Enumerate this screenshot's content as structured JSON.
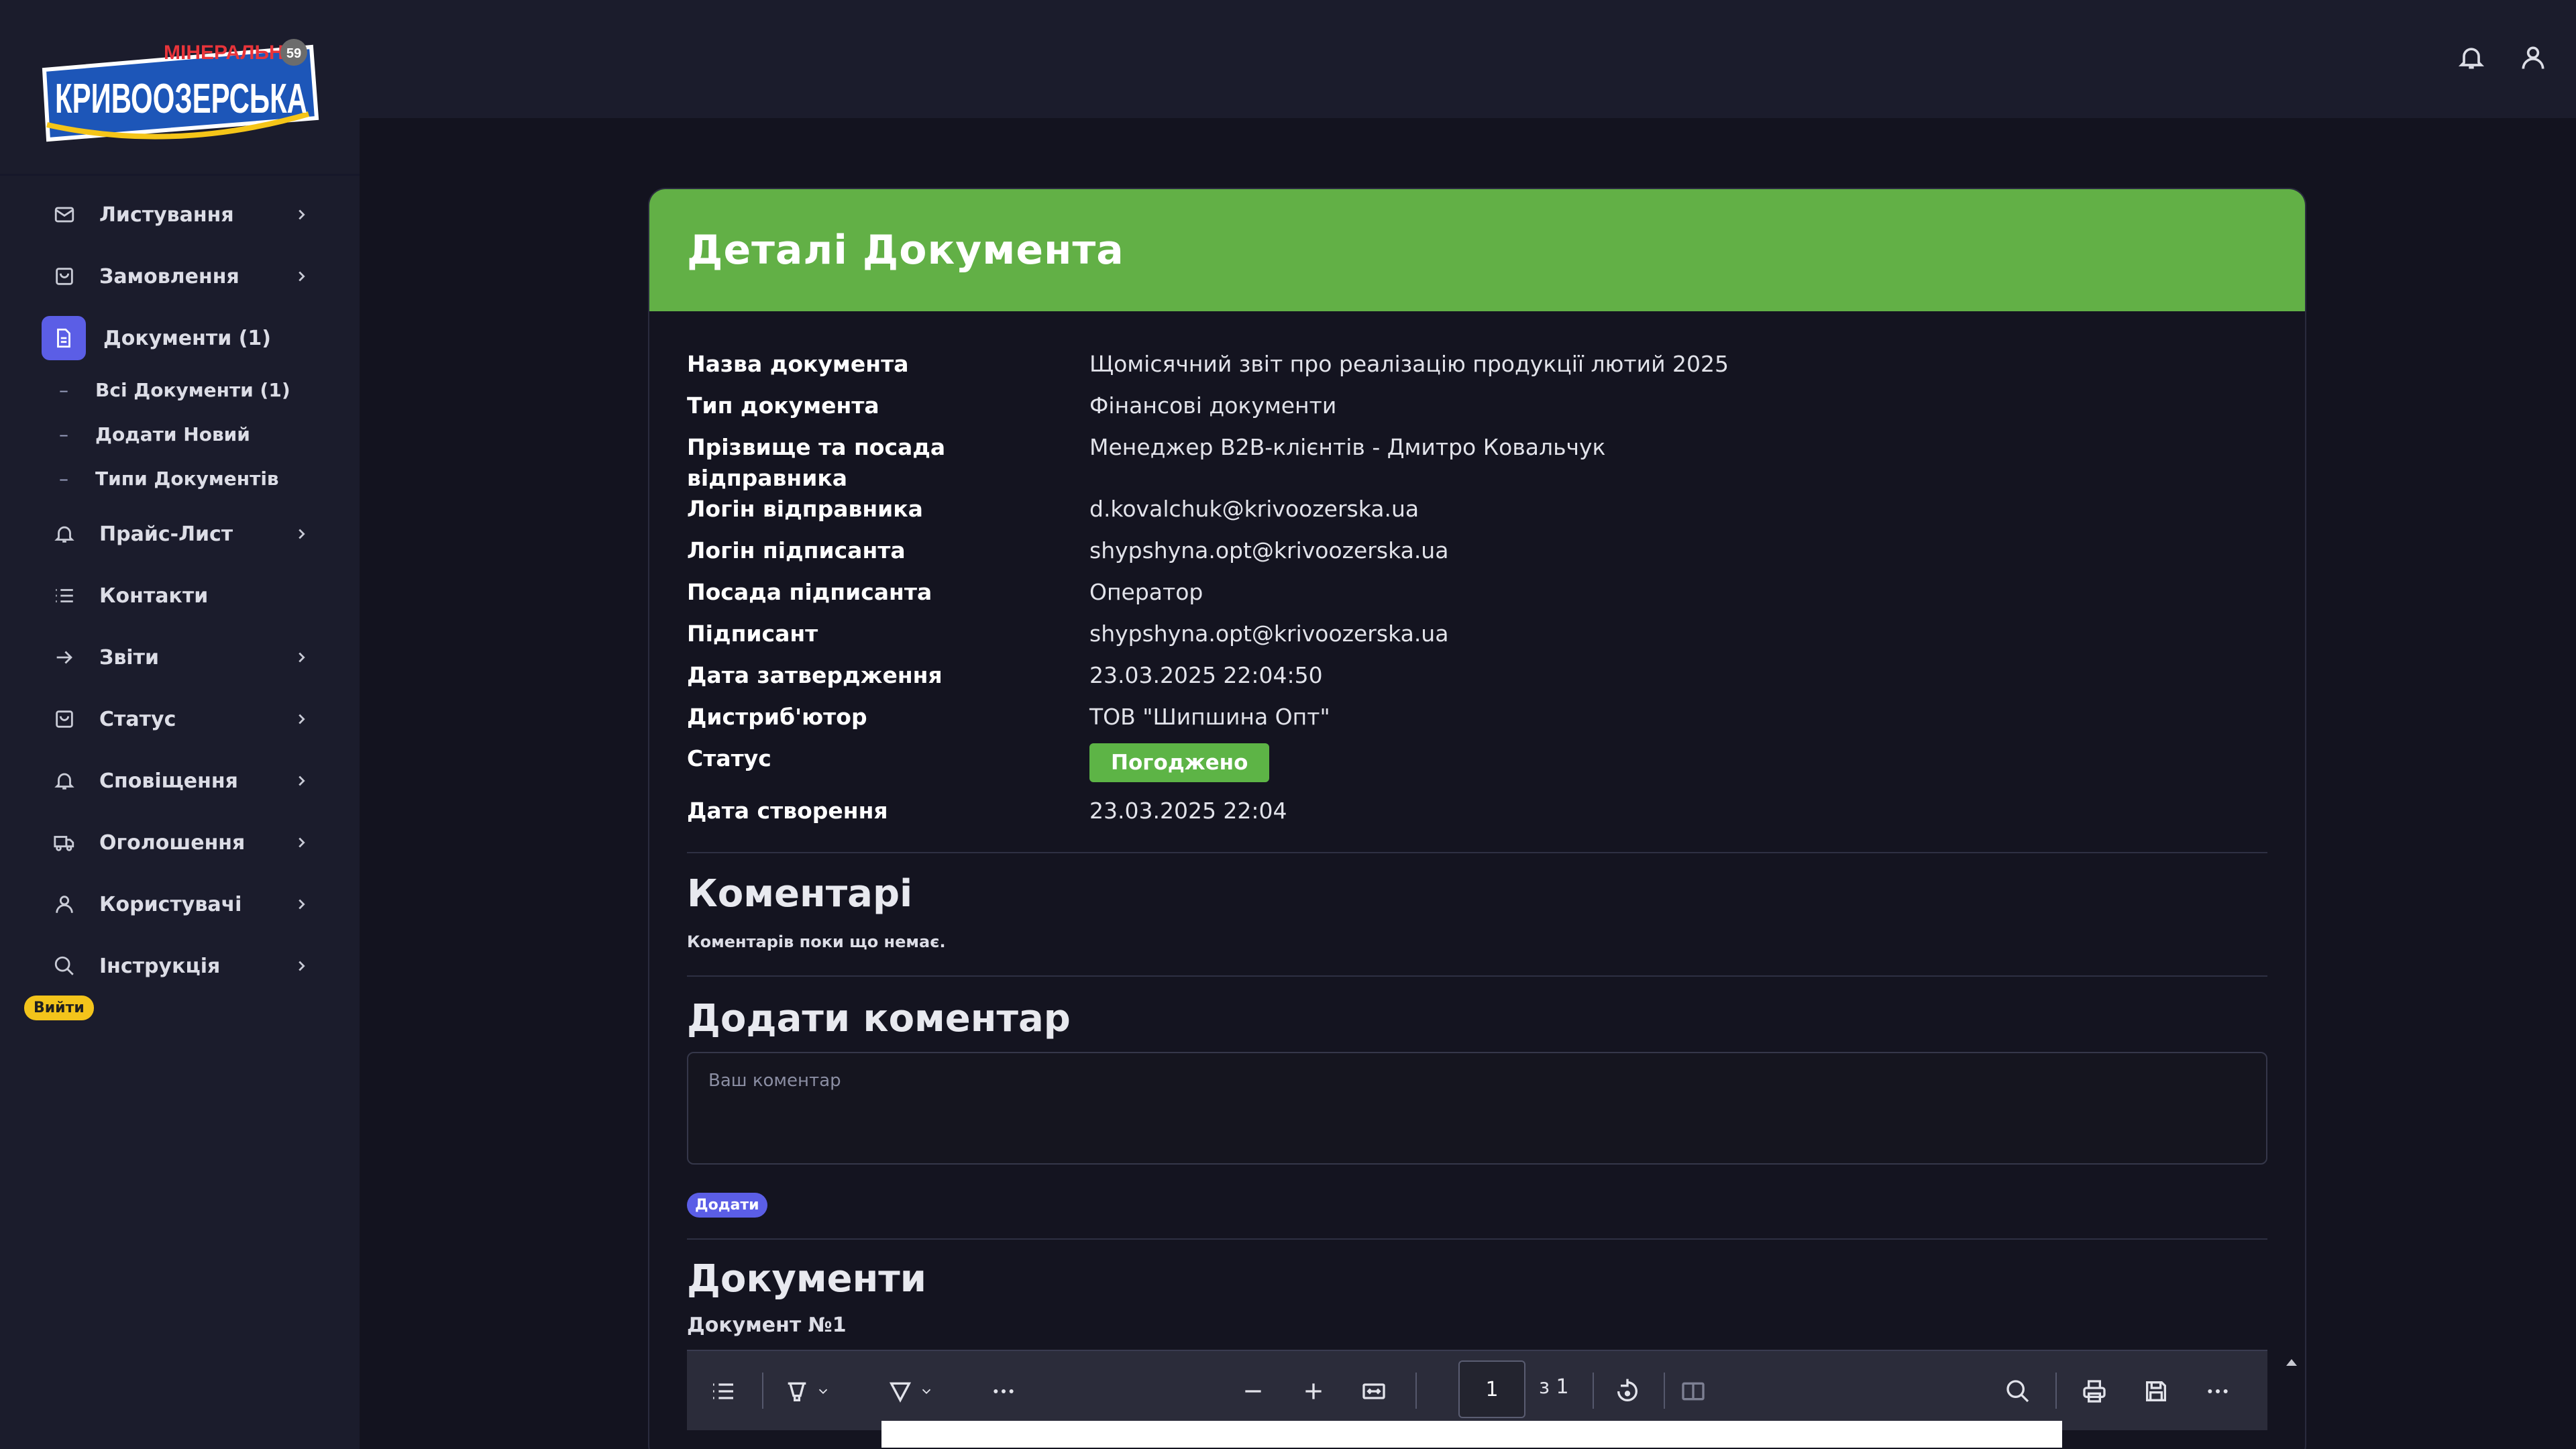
{
  "brand": {
    "logo_top": "МІНЕРАЛЬНА",
    "logo_main": "КРИВООЗЕРСЬКА",
    "logo_badge": "59"
  },
  "sidebar": {
    "items": [
      {
        "label": "Листування",
        "icon": "mail-icon"
      },
      {
        "label": "Замовлення",
        "icon": "bag-icon"
      },
      {
        "label": "Документи (1)",
        "icon": "document-icon"
      },
      {
        "label": "Прайс-Лист",
        "icon": "bell-icon"
      },
      {
        "label": "Контакти",
        "icon": "list-icon"
      },
      {
        "label": "Звіти",
        "icon": "arrow-right-icon"
      },
      {
        "label": "Статус",
        "icon": "bag-icon"
      },
      {
        "label": "Сповіщення",
        "icon": "bell-icon"
      },
      {
        "label": "Оголошення",
        "icon": "truck-icon"
      },
      {
        "label": "Користувачі",
        "icon": "user-icon"
      },
      {
        "label": "Інструкція",
        "icon": "search-icon"
      }
    ],
    "subitems": [
      {
        "label": "Всі Документи (1)"
      },
      {
        "label": "Додати Новий"
      },
      {
        "label": "Типи Документів"
      }
    ],
    "logout": "Вийти"
  },
  "header": {
    "icons": [
      "bell-icon",
      "user-icon"
    ]
  },
  "card": {
    "title": "Деталі Документа",
    "fields": [
      {
        "key": "Назва документа",
        "value": "Щомісячний звіт про реалізацію продукції лютий 2025"
      },
      {
        "key": "Тип документа",
        "value": "Фінансові документи"
      },
      {
        "key": "Прізвище та посада відправника",
        "value": "Менеджер B2B-клієнтів - Дмитро Ковальчук"
      },
      {
        "key": "Логін відправника",
        "value": "d.kovalchuk@krivoozerska.ua"
      },
      {
        "key": "Логін підписанта",
        "value": "shypshyna.opt@krivoozerska.ua"
      },
      {
        "key": "Посада підписанта",
        "value": "Оператор"
      },
      {
        "key": "Підписант",
        "value": "shypshyna.opt@krivoozerska.ua"
      },
      {
        "key": "Дата затвердження",
        "value": "23.03.2025 22:04:50"
      },
      {
        "key": "Дистриб'ютор",
        "value": "ТОВ \"Шипшина Опт\""
      },
      {
        "key": "Статус",
        "value": "Погоджено"
      },
      {
        "key": "Дата створення",
        "value": "23.03.2025 22:04"
      }
    ],
    "status_color": "#5db446",
    "comments": {
      "title": "Коментарі",
      "empty_text": "Коментарів поки що немає."
    },
    "add_comment": {
      "title": "Додати коментар",
      "placeholder": "Ваш коментар",
      "button": "Додати"
    },
    "documents": {
      "title": "Документи",
      "doc_label": "Документ №1"
    }
  },
  "pdf_toolbar": {
    "page": "1",
    "page_of": "з 1"
  },
  "colors": {
    "accent": "#62b046",
    "primary": "#5b5ee6",
    "sidebar_bg": "#1b1c2c",
    "page_bg": "#13131f"
  }
}
